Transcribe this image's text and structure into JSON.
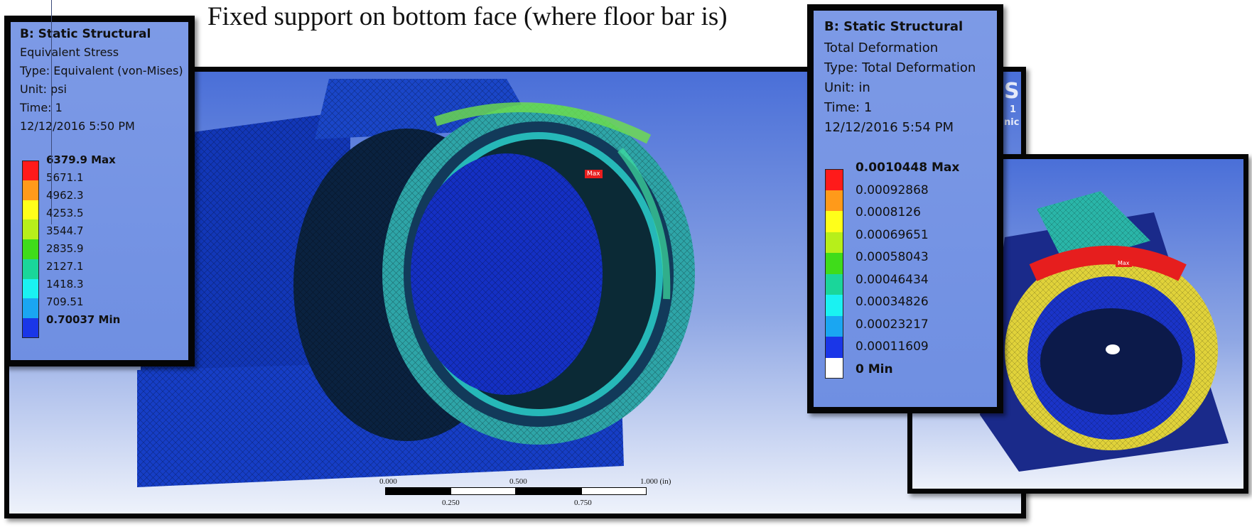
{
  "caption": "Fixed support on bottom face (where floor bar is)",
  "stress_legend": {
    "title": "B: Static Structural",
    "lines": [
      "Equivalent Stress",
      "Type: Equivalent (von-Mises)",
      "Unit: psi",
      "Time: 1",
      "12/12/2016 5:50 PM"
    ],
    "levels": [
      "6379.9 Max",
      "5671.1",
      "4962.3",
      "4253.5",
      "3544.7",
      "2835.9",
      "2127.1",
      "1418.3",
      "709.51",
      "0.70037 Min"
    ],
    "colors": [
      "#ff1a1a",
      "#ff9a1a",
      "#ffff1a",
      "#b7ef1a",
      "#3fdc1a",
      "#1ad69a",
      "#1af2f2",
      "#1aa6f2",
      "#1a36e8"
    ]
  },
  "deform_legend": {
    "title": "B: Static Structural",
    "lines": [
      "Total Deformation",
      "Type: Total Deformation",
      "Unit: in",
      "Time: 1",
      "12/12/2016 5:54 PM"
    ],
    "levels": [
      "0.0010448 Max",
      "0.00092868",
      "0.0008126",
      "0.00069651",
      "0.00058043",
      "0.00046434",
      "0.00034826",
      "0.00023217",
      "0.00011609",
      "0 Min"
    ],
    "colors": [
      "#ff1a1a",
      "#ff9a1a",
      "#ffff1a",
      "#b7ef1a",
      "#3fdc1a",
      "#1ad69a",
      "#1af2f2",
      "#1aa6f2",
      "#1a36e8",
      "#ffffff"
    ]
  },
  "scale_bar": {
    "top_labels": [
      "0.000",
      "0.500",
      "1.000 (in)"
    ],
    "bottom_labels": [
      "0.250",
      "0.750"
    ]
  },
  "markers": {
    "max_label": "Max"
  },
  "ansys_fragments": {
    "big": "S",
    "small1": "1",
    "small2": "nic"
  }
}
